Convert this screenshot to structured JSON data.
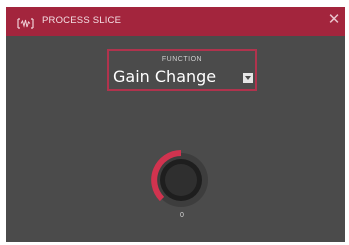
{
  "window": {
    "title": "PROCESS SLICE",
    "icons": {
      "app": "waveform-icon",
      "close": "close-icon"
    },
    "colors": {
      "titlebar": "#a3253d",
      "background": "#4b4b4b",
      "accent": "#d1334f"
    }
  },
  "function": {
    "label": "FUNCTION",
    "value": "Gain Change",
    "dropdown_icon": "dropdown-arrow-icon"
  },
  "knob": {
    "value": "0",
    "icon": "rotary-knob-icon"
  }
}
